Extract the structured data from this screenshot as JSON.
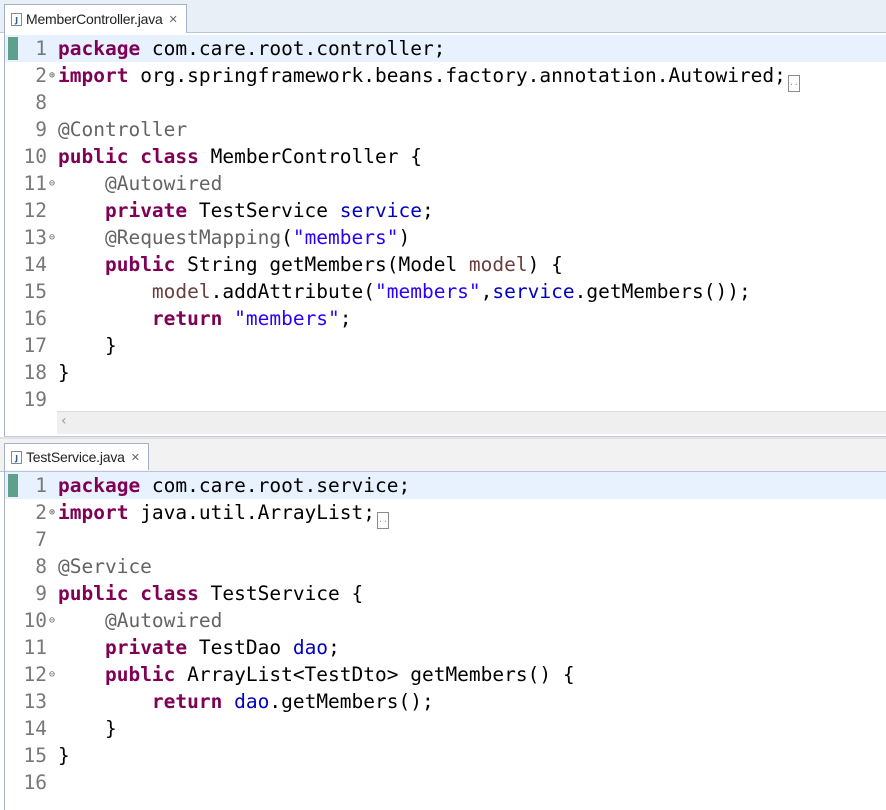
{
  "editors": [
    {
      "tab_label": "MemberController.java",
      "lines": [
        {
          "num": "1",
          "fold": "",
          "current": true,
          "segs": [
            [
              "kw",
              "package"
            ],
            [
              "",
              "com.care.root.controller;"
            ]
          ]
        },
        {
          "num": "2",
          "fold": "plus",
          "current": false,
          "segs": [
            [
              "kw",
              "import"
            ],
            [
              "",
              "org.springframework.beans.factory.annotation.Autowired;"
            ]
          ],
          "folded": true
        },
        {
          "num": "8",
          "fold": "",
          "current": false,
          "segs": []
        },
        {
          "num": "9",
          "fold": "",
          "current": false,
          "segs": [
            [
              "an",
              "@Controller"
            ]
          ]
        },
        {
          "num": "10",
          "fold": "",
          "current": false,
          "segs": [
            [
              "kw",
              "public"
            ],
            [
              "",
              " "
            ],
            [
              "kw",
              "class"
            ],
            [
              "",
              " MemberController {"
            ]
          ]
        },
        {
          "num": "11",
          "fold": "minus",
          "current": false,
          "segs": [
            [
              "",
              " "
            ],
            [
              "an",
              "@Autowired"
            ]
          ]
        },
        {
          "num": "12",
          "fold": "",
          "current": false,
          "segs": [
            [
              "",
              " "
            ],
            [
              "kw",
              "private"
            ],
            [
              "",
              " TestService "
            ],
            [
              "fd",
              "service"
            ],
            [
              "",
              ";"
            ]
          ]
        },
        {
          "num": "13",
          "fold": "minus",
          "current": false,
          "segs": [
            [
              "",
              " "
            ],
            [
              "an",
              "@RequestMapping"
            ],
            [
              "",
              "("
            ],
            [
              "st",
              "\"members\""
            ],
            [
              "",
              ")"
            ]
          ]
        },
        {
          "num": "14",
          "fold": "",
          "current": false,
          "segs": [
            [
              "",
              " "
            ],
            [
              "kw",
              "public"
            ],
            [
              "",
              " String getMembers(Model "
            ],
            [
              "pm",
              "model"
            ],
            [
              "",
              ") {"
            ]
          ]
        },
        {
          "num": "15",
          "fold": "",
          "current": false,
          "segs": [
            [
              "",
              " "
            ],
            [
              "pm",
              "model"
            ],
            [
              "",
              ".addAttribute("
            ],
            [
              "st",
              "\"members\""
            ],
            [
              "",
              ","
            ],
            [
              "fd",
              "service"
            ],
            [
              "",
              ".getMembers());"
            ]
          ]
        },
        {
          "num": "16",
          "fold": "",
          "current": false,
          "segs": [
            [
              "",
              " "
            ],
            [
              "kw",
              "return"
            ],
            [
              "",
              " "
            ],
            [
              "st",
              "\"members\""
            ],
            [
              "",
              ";"
            ]
          ]
        },
        {
          "num": "17",
          "fold": "",
          "current": false,
          "segs": [
            [
              "",
              " }"
            ]
          ]
        },
        {
          "num": "18",
          "fold": "",
          "current": false,
          "segs": [
            [
              "",
              "}"
            ]
          ]
        },
        {
          "num": "19",
          "fold": "",
          "current": false,
          "segs": []
        }
      ]
    },
    {
      "tab_label": "TestService.java",
      "lines": [
        {
          "num": "1",
          "fold": "",
          "current": true,
          "segs": [
            [
              "kw",
              "package"
            ],
            [
              "",
              " com.care.root.service;"
            ]
          ]
        },
        {
          "num": "2",
          "fold": "plus",
          "current": false,
          "segs": [
            [
              "kw",
              "import"
            ],
            [
              "",
              " java.util.ArrayList;"
            ]
          ],
          "folded": true
        },
        {
          "num": "7",
          "fold": "",
          "current": false,
          "segs": []
        },
        {
          "num": "8",
          "fold": "",
          "current": false,
          "segs": [
            [
              "an",
              "@Service"
            ]
          ]
        },
        {
          "num": "9",
          "fold": "",
          "current": false,
          "segs": [
            [
              "kw",
              "public"
            ],
            [
              "",
              " "
            ],
            [
              "kw",
              "class"
            ],
            [
              "",
              " TestService {"
            ]
          ]
        },
        {
          "num": "10",
          "fold": "minus",
          "current": false,
          "segs": [
            [
              "",
              " "
            ],
            [
              "an",
              "@Autowired"
            ]
          ]
        },
        {
          "num": "11",
          "fold": "",
          "current": false,
          "segs": [
            [
              "",
              " "
            ],
            [
              "kw",
              "private"
            ],
            [
              "",
              " TestDao "
            ],
            [
              "fd",
              "dao"
            ],
            [
              "",
              ";"
            ]
          ]
        },
        {
          "num": "12",
          "fold": "minus",
          "current": false,
          "segs": [
            [
              "",
              " "
            ],
            [
              "kw",
              "public"
            ],
            [
              "",
              " ArrayList<TestDto> getMembers() {"
            ]
          ]
        },
        {
          "num": "13",
          "fold": "",
          "current": false,
          "segs": [
            [
              "",
              " "
            ],
            [
              "kw",
              "return"
            ],
            [
              "",
              " "
            ],
            [
              "fd",
              "dao"
            ],
            [
              "",
              ".getMembers();"
            ]
          ]
        },
        {
          "num": "14",
          "fold": "",
          "current": false,
          "segs": [
            [
              "",
              " }"
            ]
          ]
        },
        {
          "num": "15",
          "fold": "",
          "current": false,
          "segs": [
            [
              "",
              "}"
            ]
          ]
        },
        {
          "num": "16",
          "fold": "",
          "current": false,
          "segs": []
        }
      ]
    }
  ]
}
